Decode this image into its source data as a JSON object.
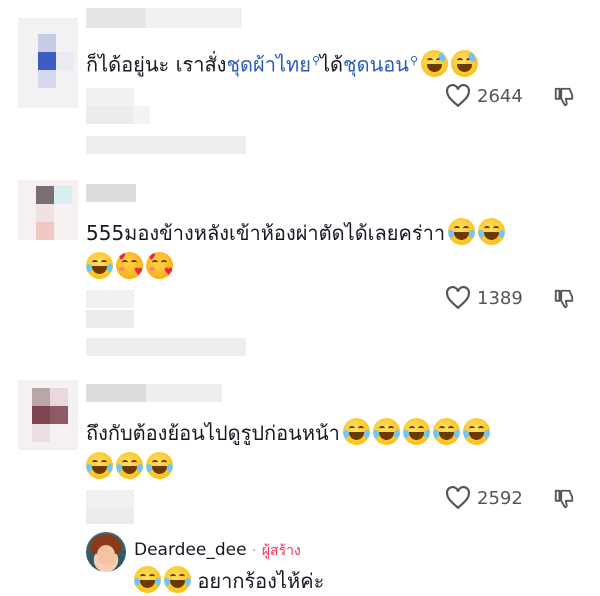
{
  "comments": [
    {
      "text_parts": [
        {
          "text": "ก็ได้อยู่นะ เราสั่ง",
          "kind": "plain"
        },
        {
          "text": "ชุดผ้าไทย",
          "kind": "keyword"
        },
        {
          "text": "ได้",
          "kind": "plain"
        },
        {
          "text": "ชุดนอน",
          "kind": "keyword"
        }
      ],
      "likes": "2644"
    },
    {
      "text_line1": "555มองข้างหลังเข้าห้องผ่าตัดได้เลยคร่าา",
      "likes": "1389"
    },
    {
      "text_line1": "ถึงกับต้องย้อนไปดูรูปก่อนหน้า",
      "likes": "2592"
    }
  ],
  "reply": {
    "username": "Deardee_dee",
    "separator": "·",
    "creator_label": "ผู้สร้าง",
    "text": "อยากร้องไห้ค่ะ"
  },
  "icons": {
    "like": "heart-outline-icon",
    "dislike": "thumbs-down-icon",
    "search": "search-keyword-icon"
  },
  "colors": {
    "keyword": "#2b5db7",
    "creator": "#fe2c55",
    "text": "#161823"
  }
}
